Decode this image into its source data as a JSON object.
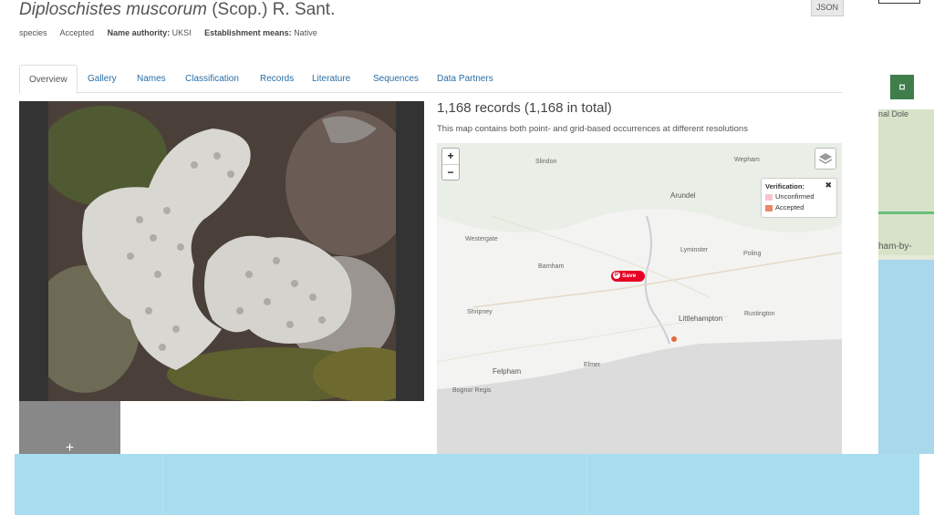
{
  "header": {
    "scientific_name": "Diploschistes muscorum",
    "authority_text": "(Scop.) R. Sant.",
    "json_label": "JSON"
  },
  "meta": {
    "rank": "species",
    "status": "Accepted",
    "name_authority_label": "Name authority:",
    "name_authority_value": "UKSI",
    "establishment_label": "Establishment means:",
    "establishment_value": "Native"
  },
  "tabs": [
    {
      "label": "Overview",
      "active": true
    },
    {
      "label": "Gallery"
    },
    {
      "label": "Names"
    },
    {
      "label": "Classification"
    },
    {
      "label": "Records"
    },
    {
      "label": "Literature"
    },
    {
      "label": "Sequences"
    },
    {
      "label": "Data Partners"
    }
  ],
  "gallery": {
    "add_label": "+"
  },
  "records": {
    "title": "1,168 records (1,168 in total)",
    "note": "This map contains both point- and grid-based occurrences at different resolutions"
  },
  "map": {
    "zoom_in": "+",
    "zoom_out": "−",
    "legend_title": "Verification:",
    "legend_close": "✖",
    "legend_items": [
      {
        "label": "Unconfirmed",
        "color": "#f5c6cf"
      },
      {
        "label": "Accepted",
        "color": "#e8896a"
      }
    ],
    "save_label": "Save",
    "towns": [
      "Slindon",
      "Wepham",
      "Arundel",
      "Westergate",
      "Lyminster",
      "Poling",
      "Barnham",
      "Shripney",
      "Littlehampton",
      "Rustington",
      "Elmer",
      "Felpham",
      "Bognor Regis"
    ]
  },
  "side_map": {
    "label_top": "nal Dole",
    "label_mid": "ham-by-"
  },
  "colors": {
    "link": "#2a6ea6",
    "green_button": "#3f7d4b",
    "sea": "#a9dcef"
  }
}
